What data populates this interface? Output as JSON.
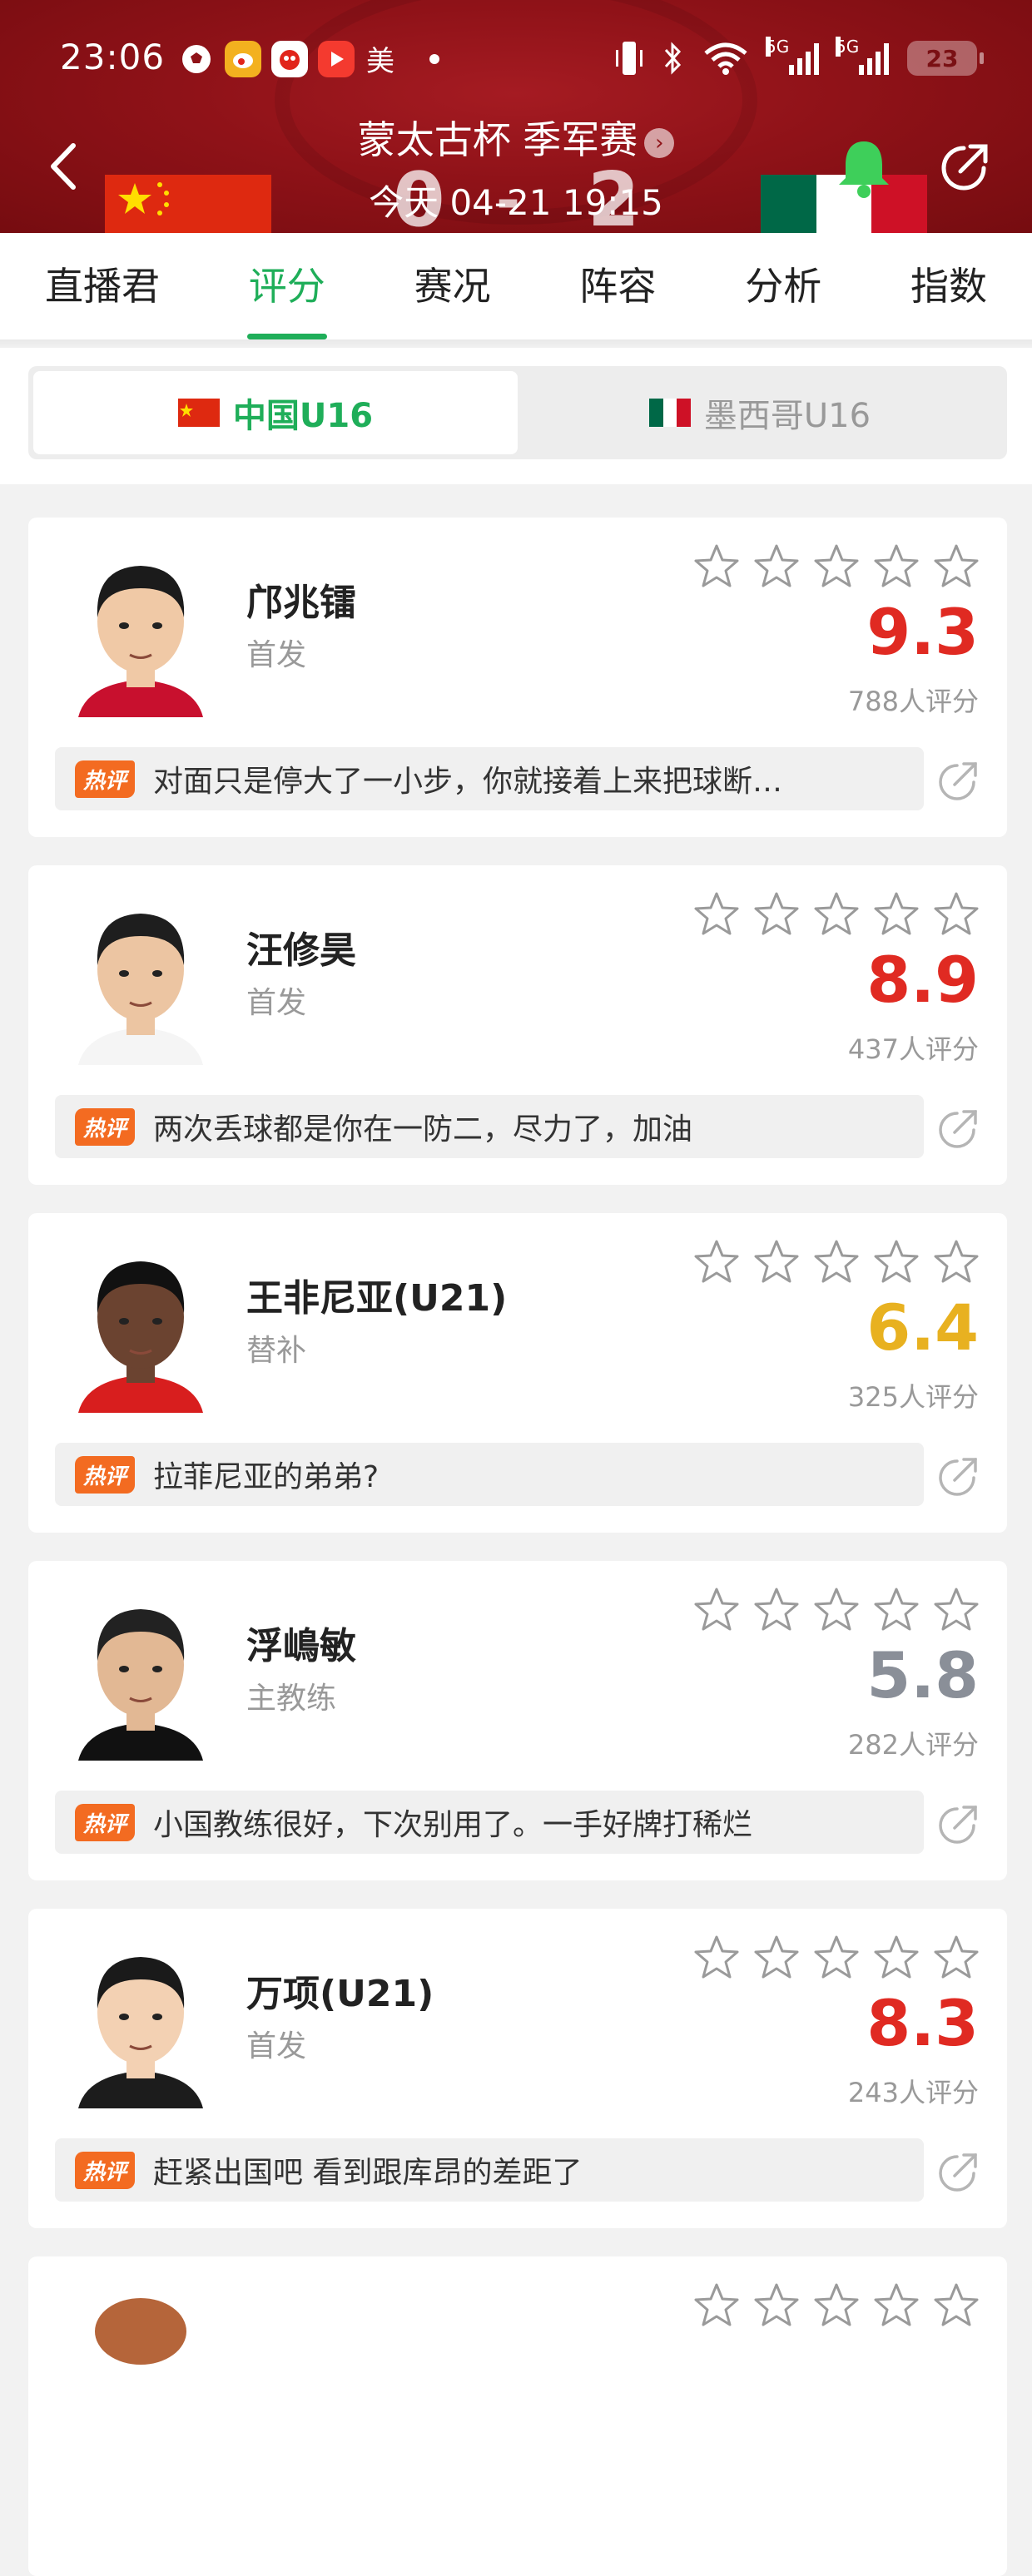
{
  "status_bar": {
    "time": "23:06",
    "app_mei": "美",
    "net1": "5G",
    "net2": "5G",
    "battery": "23"
  },
  "header": {
    "match_title": "蒙太古杯 季军赛",
    "match_sub": "今天 04-21 19:15",
    "score_home": "0",
    "score_sep": "-",
    "score_away": "2"
  },
  "tabs": [
    "直播君",
    "评分",
    "赛况",
    "阵容",
    "分析",
    "指数"
  ],
  "teams": {
    "home": "中国U16",
    "away": "墨西哥U16"
  },
  "colors": {
    "accent": "#1fae59",
    "score_high": "#e02a22",
    "score_mid": "#e8b120",
    "score_low": "#8a8f98",
    "hot_tag": "#f36b21"
  },
  "hot_label": "热评",
  "players": [
    {
      "name": "邝兆镭",
      "role": "首发",
      "score": "9.3",
      "votes": "788人评分",
      "comment": "对面只是停大了一小步，你就接着上来把球断…"
    },
    {
      "name": "汪修昊",
      "role": "首发",
      "score": "8.9",
      "votes": "437人评分",
      "comment": "两次丢球都是你在一防二，尽力了，加油"
    },
    {
      "name": "王非尼亚(U21)",
      "role": "替补",
      "score": "6.4",
      "votes": "325人评分",
      "comment": "拉菲尼亚的弟弟?"
    },
    {
      "name": "浮嶋敏",
      "role": "主教练",
      "score": "5.8",
      "votes": "282人评分",
      "comment": "小国教练很好，下次别用了。一手好牌打稀烂"
    },
    {
      "name": "万项(U21)",
      "role": "首发",
      "score": "8.3",
      "votes": "243人评分",
      "comment": "赶紧出国吧 看到跟库昂的差距了"
    }
  ]
}
